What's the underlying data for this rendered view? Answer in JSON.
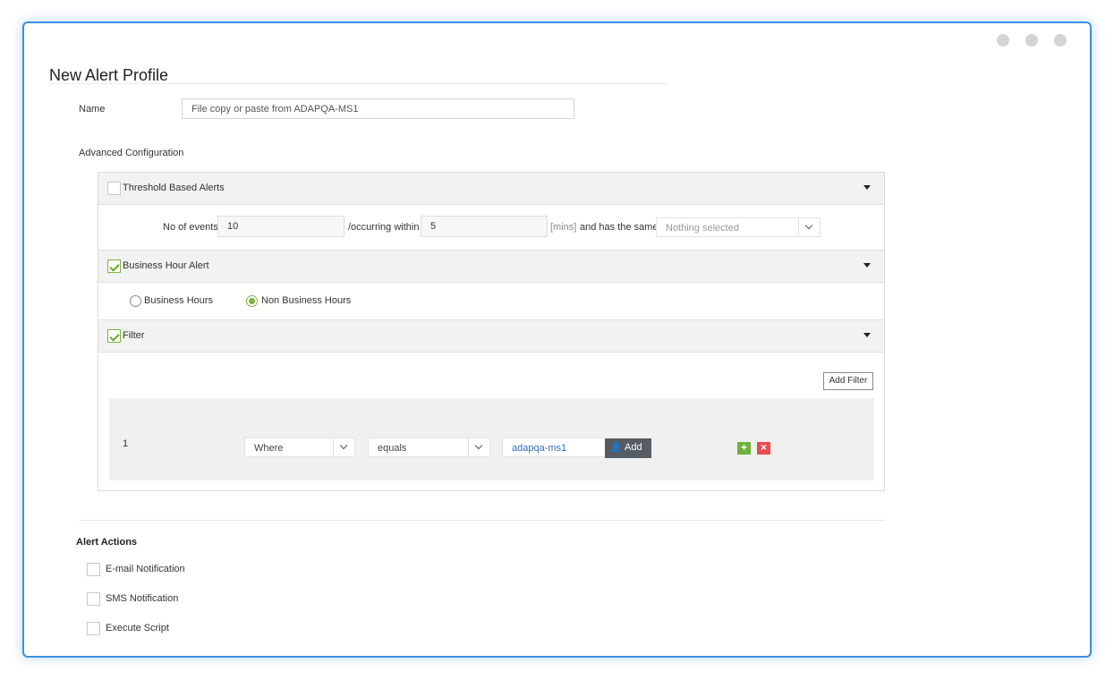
{
  "window": {
    "title": "New Alert Profile"
  },
  "name": {
    "label": "Name",
    "value": "File copy or paste from ADAPQA-MS1"
  },
  "advanced": {
    "label": "Advanced Configuration"
  },
  "threshold": {
    "label": "Threshold Based Alerts",
    "checked": false,
    "no_of_events_label": "No of events",
    "no_of_events_value": "10",
    "occurring_label": "/occurring within",
    "occurring_value": "5",
    "mins_label": "[mins]",
    "has_same_label": "and has the same",
    "has_same_select": "Nothing selected"
  },
  "business_hour": {
    "label": "Business Hour Alert",
    "checked": true,
    "options": [
      "Business Hours",
      "Non Business Hours"
    ],
    "selected": "Non Business Hours"
  },
  "filter": {
    "label": "Filter",
    "checked": true,
    "add_filter_label": "Add Filter",
    "row": {
      "index": "1",
      "field": "Where",
      "operator": "equals",
      "value": "adapqa-ms1",
      "add_label": "Add",
      "plus_label": "+",
      "remove_label": "×"
    }
  },
  "alert_actions": {
    "title": "Alert Actions",
    "items": [
      "E-mail Notification",
      "SMS Notification",
      "Execute Script"
    ]
  },
  "colors": {
    "accent_green": "#7cb342",
    "window_border": "#3c8fe0",
    "remove_red": "#e84c4c"
  }
}
